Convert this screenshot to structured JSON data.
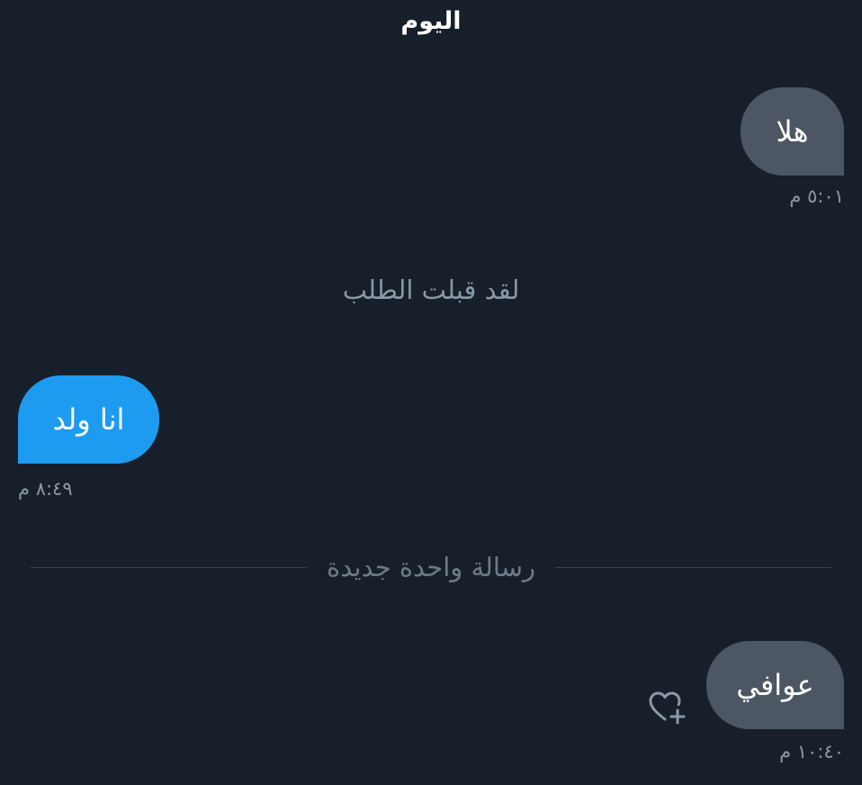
{
  "header": {
    "day": "اليوم"
  },
  "messages": [
    {
      "direction": "sent",
      "text": "هلا",
      "time": "٥:٠١ م"
    },
    {
      "direction": "received",
      "text": "انا ولد",
      "time": "٨:٤٩ م"
    },
    {
      "direction": "sent",
      "text": "عوافي",
      "time": "١٠:٤٠ م"
    }
  ],
  "system": {
    "request_accepted": "لقد قبلت الطلب"
  },
  "divider": {
    "label": "رسالة واحدة جديدة"
  },
  "icons": {
    "react": "heart-plus-icon"
  },
  "colors": {
    "background": "#17202a",
    "sent_bubble": "#4c5763",
    "received_bubble": "#1d9bf0",
    "muted_text": "#8b98a5"
  }
}
